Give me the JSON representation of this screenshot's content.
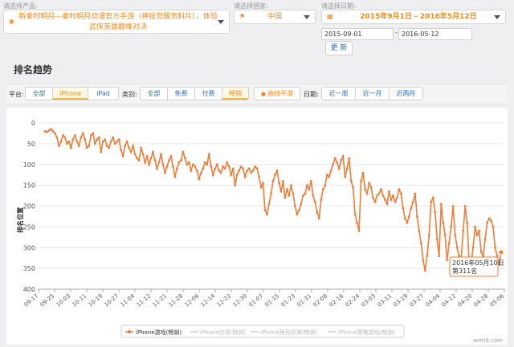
{
  "filters": {
    "product_label": "请选择产品:",
    "product_value": "新秦时明月—秦时明月动漫官方手游（神技觉醒资料片），体验武侠英雄巅峰对决",
    "country_label": "请选择国家:",
    "country_value": "中国",
    "date_label": "请选择日期:",
    "date_range": "2015年9月1日 - 2016年5月12日",
    "date_start": "2015-09-01",
    "date_separator": "-",
    "date_end": "2016-05-12",
    "update_button": "更 新"
  },
  "section_title": "排名趋势",
  "filterbar": {
    "platform_label": "平台:",
    "platform_options": [
      "全部",
      "iPhone",
      "iPad"
    ],
    "platform_active": "iPhone",
    "category_label": "类别:",
    "category_options": [
      "全部",
      "免费",
      "付费",
      "畅销"
    ],
    "category_active": "畅销",
    "smooth_label": "曲线平滑",
    "date_label": "日期:",
    "date_options": [
      "近一周",
      "近一月",
      "近两月"
    ]
  },
  "accent_color": "#ee7d3a",
  "chart_data": {
    "type": "line",
    "ylabel": "排名位置",
    "ylim": [
      0,
      400
    ],
    "y_reversed": true,
    "yticks": [
      0,
      50,
      100,
      150,
      200,
      250,
      300,
      350,
      400
    ],
    "xtick_labels": [
      "09-17",
      "09-25",
      "10-03",
      "10-11",
      "10-19",
      "10-27",
      "11-04",
      "11-12",
      "11-21",
      "11-28",
      "12-06",
      "12-14",
      "12-22",
      "12-30",
      "01-07",
      "01-15",
      "01-23",
      "01-31",
      "02-08",
      "02-16",
      "02-24",
      "03-03",
      "03-11",
      "03-19",
      "03-27",
      "04-04",
      "04-12",
      "04-20",
      "04-28",
      "05-06"
    ],
    "series": [
      {
        "name": "iPhone游戏(畅销)",
        "color": "#ee7d3a",
        "visible": true,
        "values": [
          20,
          22,
          18,
          15,
          20,
          25,
          35,
          55,
          45,
          30,
          35,
          50,
          45,
          60,
          40,
          30,
          45,
          55,
          35,
          25,
          40,
          60,
          55,
          30,
          25,
          50,
          40,
          35,
          70,
          45,
          40,
          55,
          60,
          45,
          35,
          50,
          45,
          40,
          65,
          80,
          55,
          45,
          60,
          70,
          55,
          75,
          85,
          90,
          60,
          75,
          95,
          80,
          100,
          85,
          70,
          90,
          110,
          95,
          75,
          100,
          120,
          105,
          90,
          80,
          105,
          130,
          110,
          95,
          90,
          70,
          85,
          100,
          95,
          115,
          100,
          105,
          115,
          135,
          120,
          110,
          95,
          100,
          75,
          105,
          125,
          110,
          100,
          115,
          120,
          105,
          110,
          95,
          105,
          125,
          110,
          150,
          125,
          115,
          105,
          110,
          130,
          115,
          110,
          120,
          115,
          105,
          110,
          130,
          155,
          145,
          210,
          220,
          195,
          170,
          140,
          125,
          115,
          145,
          165,
          140,
          180,
          160,
          175,
          150,
          170,
          200,
          220,
          210,
          195,
          175,
          170,
          150,
          160,
          140,
          175,
          190,
          215,
          230,
          185,
          160,
          150,
          125,
          130,
          115,
          100,
          85,
          95,
          110,
          90,
          80,
          130,
          110,
          85,
          140,
          155,
          220,
          240,
          260,
          140,
          120,
          160,
          170,
          145,
          155,
          180,
          190,
          175,
          170,
          160,
          175,
          185,
          195,
          165,
          185,
          175,
          190,
          180,
          160,
          170,
          205,
          230,
          240,
          225,
          205,
          190,
          170,
          225,
          260,
          290,
          330,
          355,
          320,
          270,
          190,
          180,
          215,
          280,
          320,
          195,
          240,
          270,
          330,
          290,
          250,
          200,
          270,
          300,
          320,
          330,
          260,
          200,
          240,
          330,
          340,
          300,
          250,
          270,
          260,
          310,
          320,
          280,
          240,
          230,
          235,
          250,
          300,
          320,
          340,
          311
        ]
      },
      {
        "name": "iPhone应用(畅销)",
        "visible": false
      },
      {
        "name": "iPhone角色扮演(畅销)",
        "visible": false
      },
      {
        "name": "iPhone策略游戏(畅销)",
        "visible": false
      }
    ],
    "tooltip": {
      "line1": "2016年05月10日",
      "line2": "第311名"
    },
    "watermark": "anm9.com"
  }
}
